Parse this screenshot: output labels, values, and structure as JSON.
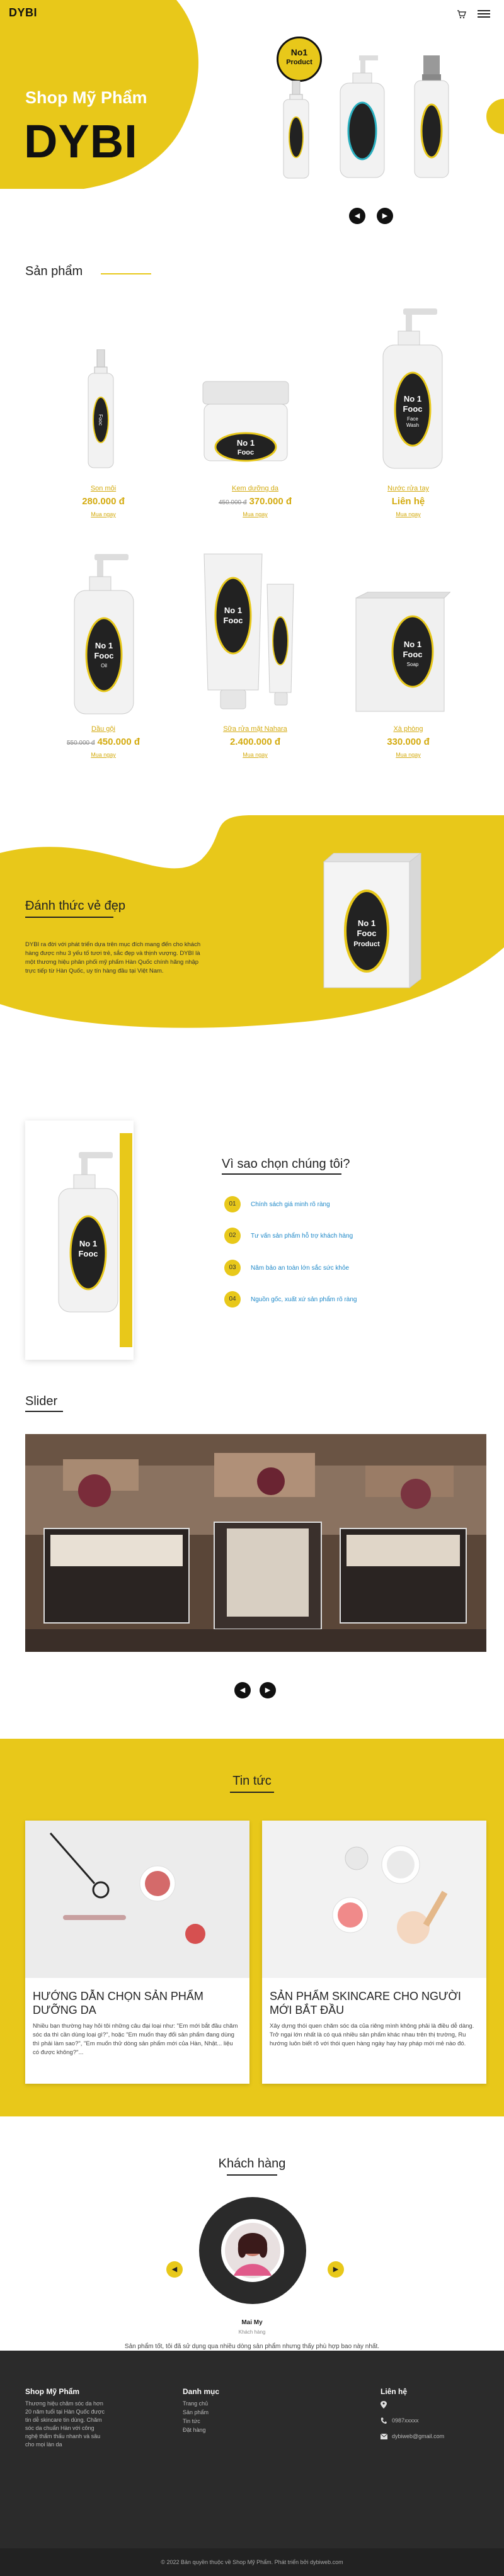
{
  "header": {
    "logo": "DYBI"
  },
  "hero": {
    "subtitle": "Shop Mỹ Phẩm",
    "title": "DYBI",
    "badge_line1": "No1",
    "badge_line2": "Product",
    "prev": "◀",
    "next": "▶"
  },
  "bottle_label": {
    "no1": "No 1",
    "fooc": "Fooc",
    "face": "Face",
    "wash": "Wash",
    "oil": "Oil",
    "soap": "Soap",
    "product": "Product"
  },
  "products": {
    "title": "Sản phẩm",
    "items": [
      {
        "name": "Son môi",
        "price": "280.000 đ",
        "old": "",
        "more": "Mua ngay"
      },
      {
        "name": "Kem dưỡng da",
        "price": "370.000 đ",
        "old": "450.000 đ",
        "more": "Mua ngay"
      },
      {
        "name": "Nước rửa tay",
        "price": "Liên hệ",
        "old": "",
        "more": "Mua ngay"
      },
      {
        "name": "Dầu gội",
        "price": "450.000 đ",
        "old": "550.000 đ",
        "more": "Mua ngay"
      },
      {
        "name": "Sữa rửa mặt Nahara",
        "price": "2.400.000 đ",
        "old": "",
        "more": "Mua ngay"
      },
      {
        "name": "Xà phòng",
        "price": "330.000 đ",
        "old": "",
        "more": "Mua ngay"
      }
    ]
  },
  "about": {
    "title": "Đánh thức vẻ đẹp",
    "text": "DYBI ra đời với phát triển dựa trên mục đích mang đến cho khách hàng được nhu 3 yếu tố tươi trẻ, sắc đẹp và thịnh vượng. DYBI là một thương hiệu phân phối mỹ phẩm Hàn Quốc chính hãng nhập trực tiếp từ Hàn Quốc, uy tín hàng đầu tại Việt Nam."
  },
  "why": {
    "title": "Vì sao chọn chúng tôi?",
    "items": [
      {
        "num": "01",
        "text": "Chính sách giá minh rõ ràng"
      },
      {
        "num": "02",
        "text": "Tư vấn sản phẩm hỗ trợ khách hàng"
      },
      {
        "num": "03",
        "text": "Nâm bảo an toàn lớn sắc sức khỏe"
      },
      {
        "num": "04",
        "text": "Nguồn gốc, xuất xứ sản phẩm rõ ràng"
      }
    ]
  },
  "slider": {
    "title": "Slider",
    "prev": "◀",
    "next": "▶"
  },
  "news": {
    "title": "Tin tức",
    "items": [
      {
        "title": "HƯỚNG DẪN CHỌN SẢN PHẨM DƯỠNG DA",
        "text": "Nhiều bạn thường hay hỏi tôi những câu đại loại như: \"Em mới bắt đầu chăm sóc da thì cần dùng loại gì?\", hoặc \"Em muốn thay đổi sản phẩm đang dùng thì phải làm sao?\", \"Em muốn thử dòng sản phẩm mới của Hàn, Nhật... liệu có được không?\"..."
      },
      {
        "title": "SẢN PHẨM SKINCARE CHO NGƯỜI MỚI BẮT ĐẦU",
        "text": "Xây dựng thói quen chăm sóc da của riêng mình không phải là điều dễ dàng. Trở ngại lớn nhất là có quá nhiều sản phẩm khác nhau trên thị trường, Ru hướng luôn biết rõ với thói quen hàng ngày hay hay pháp mới mẻ nào đó."
      }
    ]
  },
  "customers": {
    "title": "Khách hàng",
    "name": "Mai My",
    "role": "Khách hàng",
    "quote": "Sản phẩm tốt, tôi đã sử dụng qua nhiều dòng sản phẩm nhưng thấy phù hợp bao này nhất.",
    "prev": "◀",
    "next": "▶"
  },
  "footer": {
    "col1_title": "Shop Mỹ Phẩm",
    "col1_text": "Thương hiệu chăm sóc da hơn 20 năm tuổi tại Hàn Quốc được tin dễ skincare tin dùng. Chăm sóc da chuẩn Hàn với công nghệ thẩm thấu nhanh và sâu cho mọi làn da",
    "col2_title": "Danh mục",
    "col2_items": [
      "Trang chủ",
      "Sản phẩm",
      "Tin tức",
      "Đặt hàng"
    ],
    "col3_title": "Liên hệ",
    "phone": "0987xxxxx",
    "email": "dybiweb@gmail.com",
    "copyright": "© 2022 Bản quyền thuộc về Shop Mỹ Phẩm. Phát triển bởi dybiweb.com"
  },
  "colors": {
    "accent": "#e8c81a",
    "dark": "#222222"
  }
}
